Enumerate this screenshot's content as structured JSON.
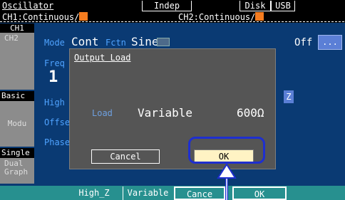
{
  "topbar": {
    "title": "Oscillator",
    "mode": "Indep",
    "disk": "Disk",
    "usb": "USB",
    "ch1_status": "CH1:Continuous/",
    "ch2_status": "CH2:Continuous/"
  },
  "tabs": {
    "ch1": "CH1",
    "ch2": "CH2",
    "basic": "Basic",
    "modu": "Modu",
    "single": "Single",
    "dual_line1": "Dual",
    "dual_line2": "Graph"
  },
  "params": {
    "mode_label": "Mode",
    "freq_label": "Freq",
    "high_label": "High",
    "offset_label": "Offse",
    "phase_label": "Phase",
    "mode_value": "Cont",
    "fctn_label": "Fctn",
    "fctn_value": "Sine",
    "freq_digit": "1",
    "off_label": "Off",
    "off_button": "...",
    "z_label": "Z"
  },
  "dialog": {
    "title": "Output Load",
    "load_label": "Load",
    "load_value": "Variable",
    "ohms": "600Ω",
    "cancel": "Cancel",
    "ok": "OK"
  },
  "softkeys": {
    "high_z": "High_Z",
    "variable": "Variable",
    "cancel": "Cance",
    "ok": "OK"
  },
  "colors": {
    "background": "#0a3a73",
    "accent_orange": "#f57c1f",
    "softkey_bar": "#27908f",
    "highlight_blue": "#1e2fd0",
    "ok_button": "#fff3c4"
  }
}
